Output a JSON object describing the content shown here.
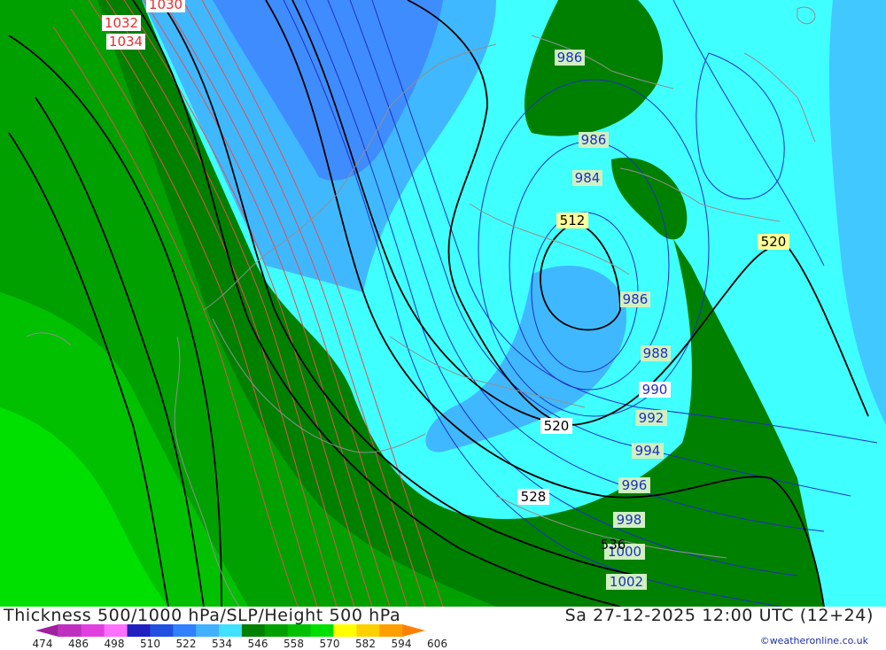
{
  "title": "Thickness 500/1000 hPa/SLP/Height 500 hPa",
  "datetime": "Sa 27-12-2025 12:00 UTC (12+24)",
  "credit": "©weatheronline.co.uk",
  "legend": {
    "ticks": [
      "474",
      "486",
      "498",
      "510",
      "522",
      "534",
      "546",
      "558",
      "570",
      "582",
      "594",
      "606"
    ],
    "colors": [
      "#a020a0",
      "#c030c0",
      "#e040e0",
      "#ff70ff",
      "#2020c0",
      "#2050e0",
      "#3080ff",
      "#40b0ff",
      "#40e0ff",
      "#008000",
      "#00a000",
      "#00c000",
      "#00e000",
      "#ffff00",
      "#ffd000",
      "#ffa000",
      "#ff8000"
    ]
  },
  "map_labels": {
    "slp_1030": "1030",
    "slp_1032": "1032",
    "slp_1034": "1034",
    "slp_986_north": "986",
    "slp_986_mid": "986",
    "slp_984": "984",
    "slp_986_low": "986",
    "slp_988": "988",
    "slp_990": "990",
    "slp_992": "992",
    "slp_994": "994",
    "slp_996": "996",
    "slp_998": "998",
    "slp_1000": "1000",
    "slp_1002": "1002",
    "hgt_512": "512",
    "hgt_520_east": "520",
    "hgt_520_south": "520",
    "hgt_528": "528",
    "hgt_536": "536"
  },
  "colors": {
    "slp_high_isobar": "#e05050",
    "slp_low_isobar": "#2030c0",
    "height_contour": "#000000",
    "coastline": "#909090"
  }
}
